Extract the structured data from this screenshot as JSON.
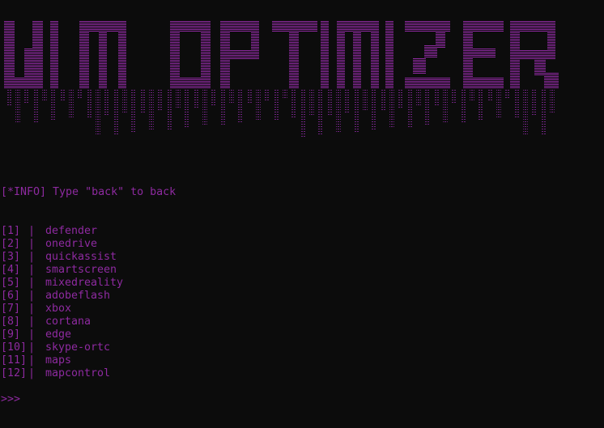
{
  "banner": {
    "title": "WM OPTIMIZER",
    "color": "#8e2aa0"
  },
  "info_line": "[*INFO] Type \"back\" to back",
  "menu": [
    {
      "num": "[1]",
      "label": "defender"
    },
    {
      "num": "[2]",
      "label": "onedrive"
    },
    {
      "num": "[3]",
      "label": "quickassist"
    },
    {
      "num": "[4]",
      "label": "smartscreen"
    },
    {
      "num": "[5]",
      "label": "mixedreality"
    },
    {
      "num": "[6]",
      "label": "adobeflash"
    },
    {
      "num": "[7]",
      "label": "xbox"
    },
    {
      "num": "[8]",
      "label": "cortana"
    },
    {
      "num": "[9]",
      "label": "edge"
    },
    {
      "num": "[10]",
      "label": "skype-ortc"
    },
    {
      "num": "[11]",
      "label": "maps"
    },
    {
      "num": "[12]",
      "label": "mapcontrol"
    }
  ],
  "separator": "|",
  "prompt": ">>>",
  "colors": {
    "background": "#0c0c0c",
    "accent": "#8e2aa0"
  }
}
